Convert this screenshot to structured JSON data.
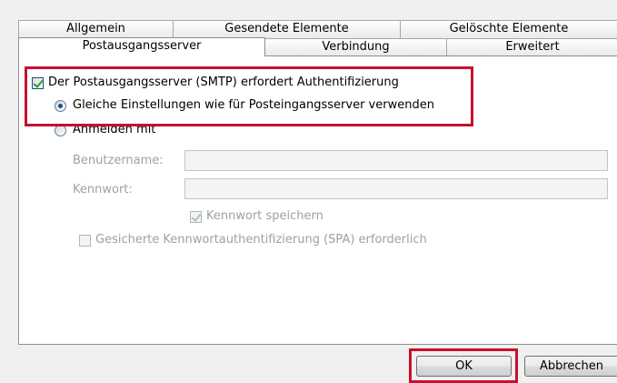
{
  "tabs_row1": [
    {
      "label": "Allgemein"
    },
    {
      "label": "Gesendete Elemente"
    },
    {
      "label": "Gelöschte Elemente"
    }
  ],
  "tabs_row2": [
    {
      "label": "Postausgangsserver",
      "active": true
    },
    {
      "label": "Verbindung"
    },
    {
      "label": "Erweitert"
    }
  ],
  "auth": {
    "requires_auth_label": "Der Postausgangsserver (SMTP) erfordert Authentifizierung",
    "requires_auth_checked": true,
    "same_settings_label": "Gleiche Einstellungen wie für Posteingangsserver verwenden",
    "same_settings_selected": true,
    "login_with_label": "Anmelden mit",
    "login_with_selected": false
  },
  "login": {
    "username_label": "Benutzername:",
    "username_value": "",
    "password_label": "Kennwort:",
    "password_value": "",
    "save_password_label": "Kennwort speichern",
    "save_password_checked": true,
    "spa_label": "Gesicherte Kennwortauthentifizierung (SPA) erforderlich",
    "spa_checked": false
  },
  "buttons": {
    "ok": "OK",
    "cancel": "Abbrechen"
  },
  "colors": {
    "highlight": "#c8102e"
  }
}
